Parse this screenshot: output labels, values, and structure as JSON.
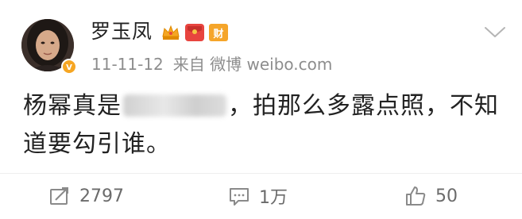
{
  "post": {
    "user": {
      "name": "罗玉凤",
      "badges": [
        "crown-badge",
        "red-packet-badge",
        "wealth-badge"
      ],
      "wealth_badge_text": "财"
    },
    "meta": {
      "date": "11-11-12",
      "source": "来自 微博 weibo.com"
    },
    "content": {
      "line1_before": "杨幂真是",
      "line1_after": "，拍那么多露点照，不知",
      "line2": "道要勾引谁。"
    },
    "actions": {
      "repost_count": "2797",
      "comment_count": "1万",
      "like_count": "50"
    },
    "colors": {
      "text": "#222222",
      "meta": "#8d8d8d",
      "action": "#6b6b6b",
      "verified": "#f6a623",
      "wealth": "#f5a52a",
      "redpacket": "#e8443f"
    }
  }
}
